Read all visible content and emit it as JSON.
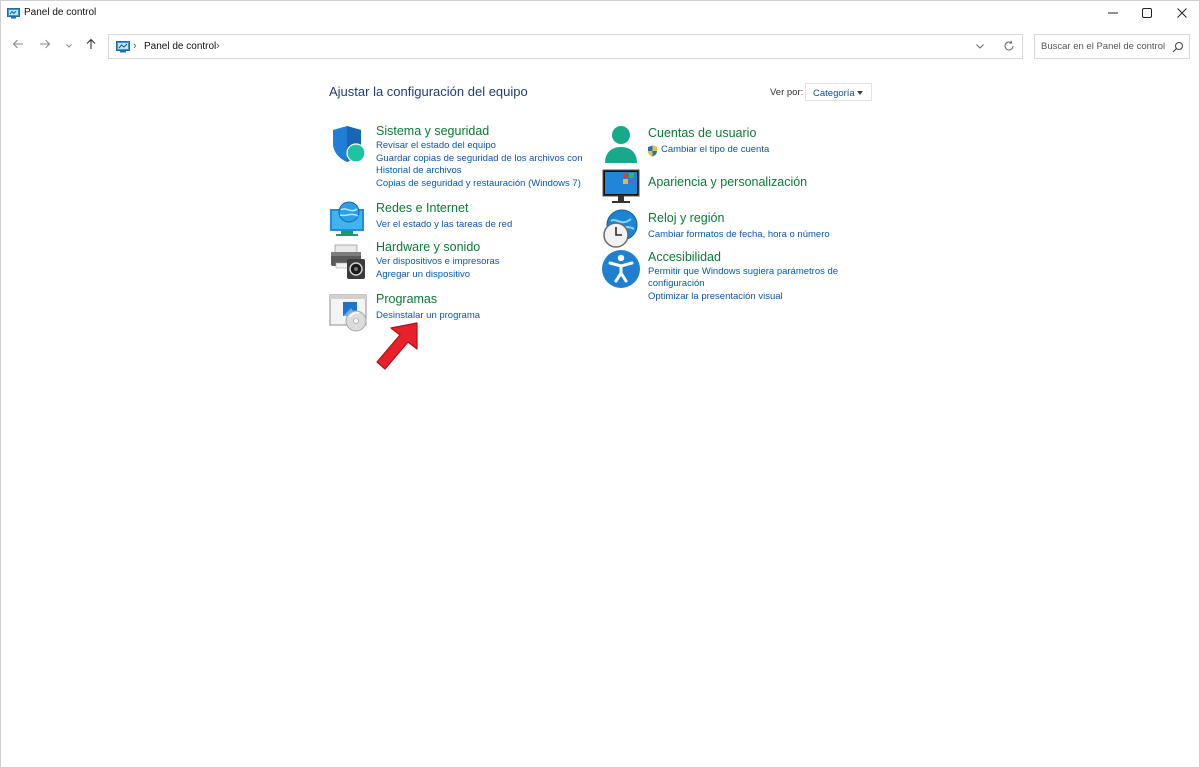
{
  "window": {
    "title": "Panel de control"
  },
  "navigation": {
    "back_icon": "arrow-left-icon",
    "forward_icon": "arrow-right-icon",
    "recent_icon": "chevron-down-icon",
    "up_icon": "arrow-up-icon",
    "breadcrumb": "Panel de control",
    "search_placeholder": "Buscar en el Panel de control"
  },
  "main": {
    "heading": "Ajustar la configuración del equipo",
    "view_by_label": "Ver por:",
    "view_by_value": "Categoría",
    "categories_left": [
      {
        "title": "Sistema y seguridad",
        "links": [
          "Revisar el estado del equipo",
          "Guardar copias de seguridad de los archivos con",
          "Historial de archivos",
          "Copias de seguridad y restauración (Windows 7)"
        ]
      },
      {
        "title": "Redes e Internet",
        "links": [
          "Ver el estado y las tareas de red"
        ]
      },
      {
        "title": "Hardware y sonido",
        "links": [
          "Ver dispositivos e impresoras",
          "Agregar un dispositivo"
        ]
      },
      {
        "title": "Programas",
        "links": [
          "Desinstalar un programa"
        ]
      }
    ],
    "categories_right": [
      {
        "title": "Cuentas de usuario",
        "links": [
          "Cambiar el tipo de cuenta"
        ]
      },
      {
        "title": "Apariencia y personalización",
        "links": []
      },
      {
        "title": "Reloj y región",
        "links": [
          "Cambiar formatos de fecha, hora o número"
        ]
      },
      {
        "title": "Accesibilidad",
        "links": [
          "Permitir que Windows sugiera parámetros de",
          "configuración",
          "Optimizar la presentación visual"
        ]
      }
    ]
  },
  "colors": {
    "category_title": "#0a7a37",
    "link": "#0a57b0",
    "heading": "#1e3d7c",
    "annotation_arrow": "#e8202a"
  }
}
